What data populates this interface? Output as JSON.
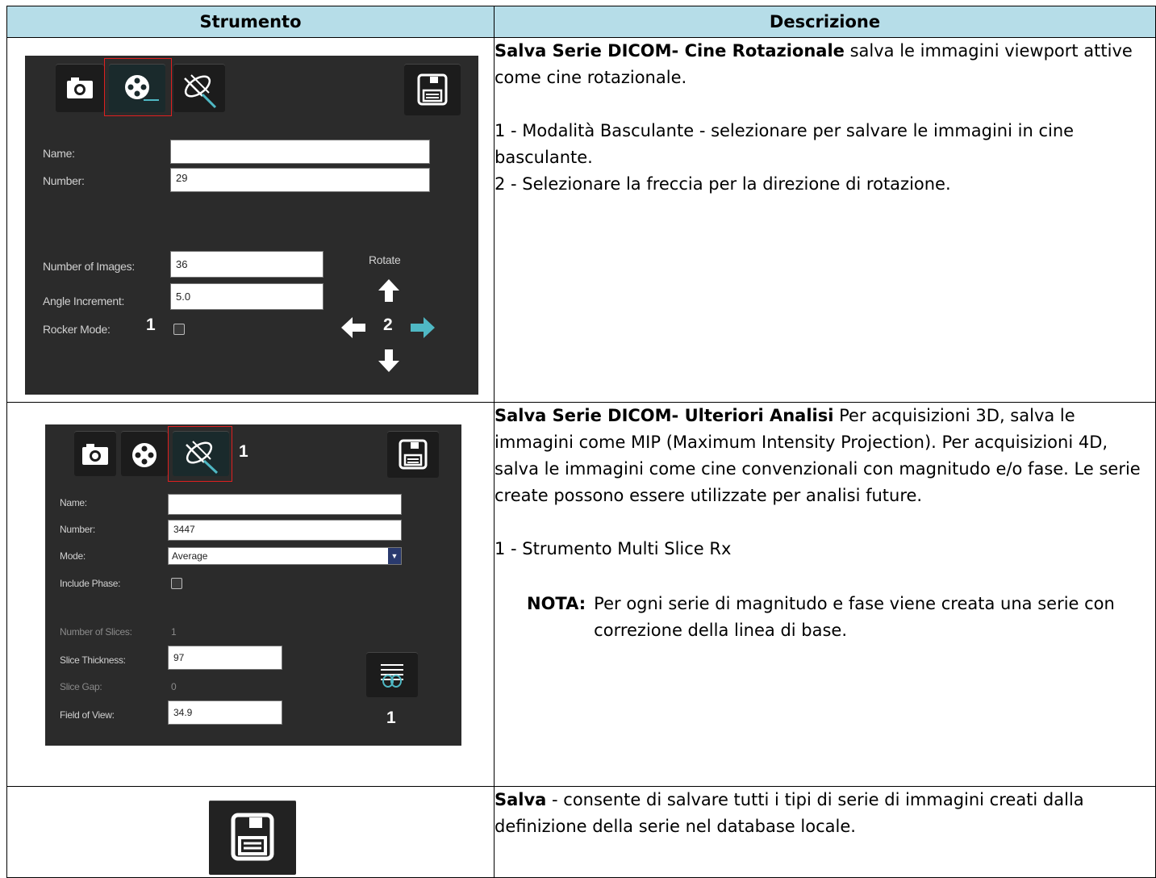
{
  "headers": {
    "tool": "Strumento",
    "description": "Descrizione"
  },
  "rows": [
    {
      "title": "Salva Serie DICOM- Cine Rotazionale",
      "intro": " salva le immagini viewport attive come cine rotazionale.",
      "items": [
        "1 - Modalità Basculante - selezionare per salvare le immagini in cine basculante.",
        "2 - Selezionare la freccia per la direzione di rotazione."
      ],
      "panel": {
        "name_label": "Name:",
        "number_label": "Number:",
        "number_value": "29",
        "images_label": "Number of Images:",
        "images_value": "36",
        "angle_label": "Angle Increment:",
        "angle_value": "5.0",
        "rocker_label": "Rocker Mode:",
        "rotate_label": "Rotate",
        "callout_1": "1",
        "callout_2": "2"
      }
    },
    {
      "title": "Salva Serie DICOM- Ulteriori Analisi",
      "intro": " Per acquisizioni 3D, salva le immagini come MIP (Maximum Intensity Projection). Per acquisizioni 4D, salva le immagini come cine convenzionali con magnitudo e/o fase. Le serie create possono essere utilizzate per analisi future.",
      "items": [
        "1 - Strumento Multi Slice Rx"
      ],
      "note_label": "NOTA:",
      "note_text": "Per ogni serie di magnitudo e fase viene creata una serie con correzione della linea di base.",
      "panel": {
        "name_label": "Name:",
        "number_label": "Number:",
        "number_value": "3447",
        "mode_label": "Mode:",
        "mode_value": "Average",
        "phase_label": "Include Phase:",
        "slices_label": "Number of Slices:",
        "slices_value": "1",
        "thickness_label": "Slice Thickness:",
        "thickness_value": "97",
        "gap_label": "Slice Gap:",
        "gap_value": "0",
        "fov_label": "Field of View:",
        "fov_value": "34.9",
        "callout_top": "1",
        "callout_bottom": "1"
      }
    },
    {
      "title": "Salva",
      "intro": " - consente di salvare tutti i tipi di serie di immagini creati dalla definizione della serie nel database locale."
    }
  ],
  "colors": {
    "header_bg": "#b6dde8",
    "highlight": "#e02020",
    "accent_arrow": "#4fb8c4"
  }
}
